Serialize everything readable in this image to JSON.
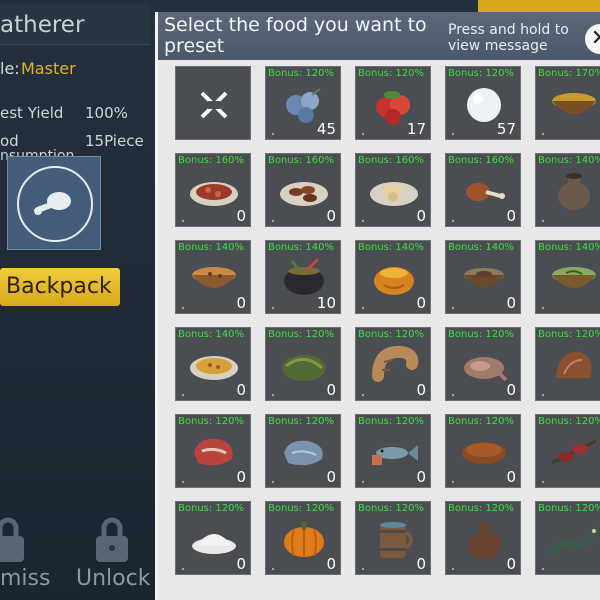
{
  "background": {
    "title": "atherer",
    "grade_label": "le:",
    "grade_value": "Master",
    "harvest_yield_label": "est Yield",
    "harvest_yield_value": "100%",
    "food_label_1": "od",
    "food_label_2": "nsumption",
    "food_value": "15Piece",
    "backpack_label": "Backpack",
    "dismiss_label": "miss",
    "unlock_label": "Unlock"
  },
  "modal": {
    "title": "Select the food you want to preset",
    "hint": "Press and hold to view message",
    "close_symbol": "✕"
  },
  "grid": {
    "cells": [
      {
        "icon": "clear-icon",
        "bonus": "",
        "qty": ""
      },
      {
        "icon": "berries-blue-icon",
        "bonus": "Bonus: 120%",
        "qty": "45"
      },
      {
        "icon": "berries-red-icon",
        "bonus": "Bonus: 120%",
        "qty": "17"
      },
      {
        "icon": "snowball-icon",
        "bonus": "Bonus: 120%",
        "qty": "57"
      },
      {
        "icon": "soup-bowl-icon",
        "bonus": "Bonus: 170%",
        "qty": ""
      },
      {
        "icon": "meat-platter-icon",
        "bonus": "Bonus: 160%",
        "qty": "0"
      },
      {
        "icon": "grilled-platter-icon",
        "bonus": "Bonus: 160%",
        "qty": "0"
      },
      {
        "icon": "dumpling-plate-icon",
        "bonus": "Bonus: 160%",
        "qty": "0"
      },
      {
        "icon": "drumstick-icon",
        "bonus": "Bonus: 160%",
        "qty": "0"
      },
      {
        "icon": "clay-pot-icon",
        "bonus": "Bonus: 140%",
        "qty": ""
      },
      {
        "icon": "porridge-bowl-icon",
        "bonus": "Bonus: 140%",
        "qty": "0"
      },
      {
        "icon": "cauldron-icon",
        "bonus": "Bonus: 140%",
        "qty": "10"
      },
      {
        "icon": "pumpkin-bowl-icon",
        "bonus": "Bonus: 140%",
        "qty": "0"
      },
      {
        "icon": "stew-bowl-icon",
        "bonus": "Bonus: 140%",
        "qty": "0"
      },
      {
        "icon": "green-soup-icon",
        "bonus": "Bonus: 140%",
        "qty": ""
      },
      {
        "icon": "curry-plate-icon",
        "bonus": "Bonus: 140%",
        "qty": "0"
      },
      {
        "icon": "leaf-bundle-icon",
        "bonus": "Bonus: 120%",
        "qty": "0"
      },
      {
        "icon": "grub-icon",
        "bonus": "Bonus: 120%",
        "qty": "0"
      },
      {
        "icon": "raw-carcass-icon",
        "bonus": "Bonus: 120%",
        "qty": "0"
      },
      {
        "icon": "shell-icon",
        "bonus": "Bonus: 120%",
        "qty": ""
      },
      {
        "icon": "raw-steak-icon",
        "bonus": "Bonus: 120%",
        "qty": "0"
      },
      {
        "icon": "raw-fish-fillet-icon",
        "bonus": "Bonus: 120%",
        "qty": "0"
      },
      {
        "icon": "fish-icon",
        "bonus": "Bonus: 120%",
        "qty": "0"
      },
      {
        "icon": "bread-icon",
        "bonus": "Bonus: 120%",
        "qty": "0"
      },
      {
        "icon": "meat-skewer-icon",
        "bonus": "Bonus: 120%",
        "qty": ""
      },
      {
        "icon": "flour-pile-icon",
        "bonus": "Bonus: 120%",
        "qty": "0"
      },
      {
        "icon": "pumpkin-icon",
        "bonus": "Bonus: 120%",
        "qty": "0"
      },
      {
        "icon": "barrel-mug-icon",
        "bonus": "Bonus: 120%",
        "qty": "0"
      },
      {
        "icon": "jug-icon",
        "bonus": "Bonus: 120%",
        "qty": "0"
      },
      {
        "icon": "eel-icon",
        "bonus": "Bonus: 120%",
        "qty": ""
      }
    ]
  },
  "colors": {
    "bonus_text": "#3ae03a",
    "backpack_button": "#e0b424",
    "grade_value": "#e3b21f"
  }
}
